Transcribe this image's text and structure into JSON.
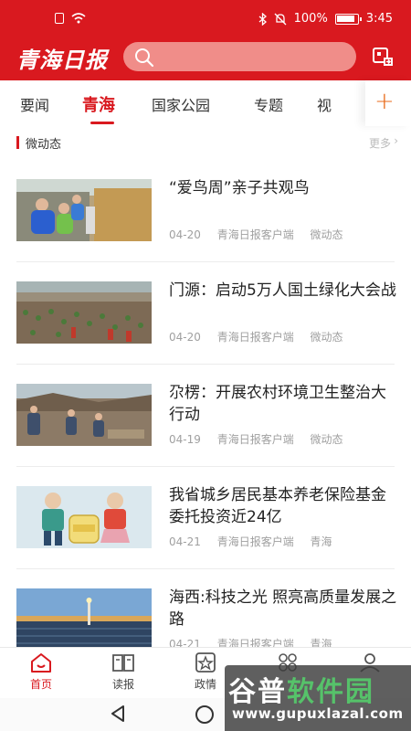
{
  "status_bar": {
    "battery": "100%",
    "time": "3:45"
  },
  "header": {
    "logo": "青海日报",
    "search_placeholder": "",
    "colors": {
      "brand": "#d9191f",
      "accent": "#e86a18"
    }
  },
  "tabs": [
    {
      "label": "要闻",
      "active": false
    },
    {
      "label": "青海",
      "active": true
    },
    {
      "label": "国家公园",
      "active": false
    },
    {
      "label": "专题",
      "active": false
    },
    {
      "label": "视",
      "active": false
    }
  ],
  "tab_add_label": "+",
  "section": {
    "title": "微动态",
    "more": "更多"
  },
  "news": [
    {
      "title": "“爱鸟周”亲子共观鸟",
      "date": "04-20",
      "source": "青海日报客户端",
      "tag": "微动态",
      "thumb": "birdwatching-photo"
    },
    {
      "title": "门源：启动5万人国土绿化大会战",
      "date": "04-20",
      "source": "青海日报客户端",
      "tag": "微动态",
      "thumb": "tree-planting-photo"
    },
    {
      "title": "尕楞：开展农村环境卫生整治大行动",
      "date": "04-19",
      "source": "青海日报客户端",
      "tag": "微动态",
      "thumb": "village-cleanup-photo"
    },
    {
      "title": "我省城乡居民基本养老保险基金委托投资近24亿",
      "date": "04-21",
      "source": "青海日报客户端",
      "tag": "青海",
      "thumb": "pension-illustration"
    },
    {
      "title": "海西:科技之光 照亮高质量发展之路",
      "date": "04-21",
      "source": "青海日报客户端",
      "tag": "青海",
      "thumb": "solar-plant-photo"
    }
  ],
  "bottom_nav": [
    {
      "label": "首页",
      "icon": "home-icon",
      "active": true
    },
    {
      "label": "读报",
      "icon": "book-icon",
      "active": false
    },
    {
      "label": "政情",
      "icon": "star-badge-icon",
      "active": false
    },
    {
      "label": "",
      "icon": "grid-icon",
      "active": false
    },
    {
      "label": "",
      "icon": "user-icon",
      "active": false
    }
  ],
  "watermark": {
    "name_part1": "谷普",
    "name_part2": "软件园",
    "url": "www.gupuxlazal.com"
  }
}
